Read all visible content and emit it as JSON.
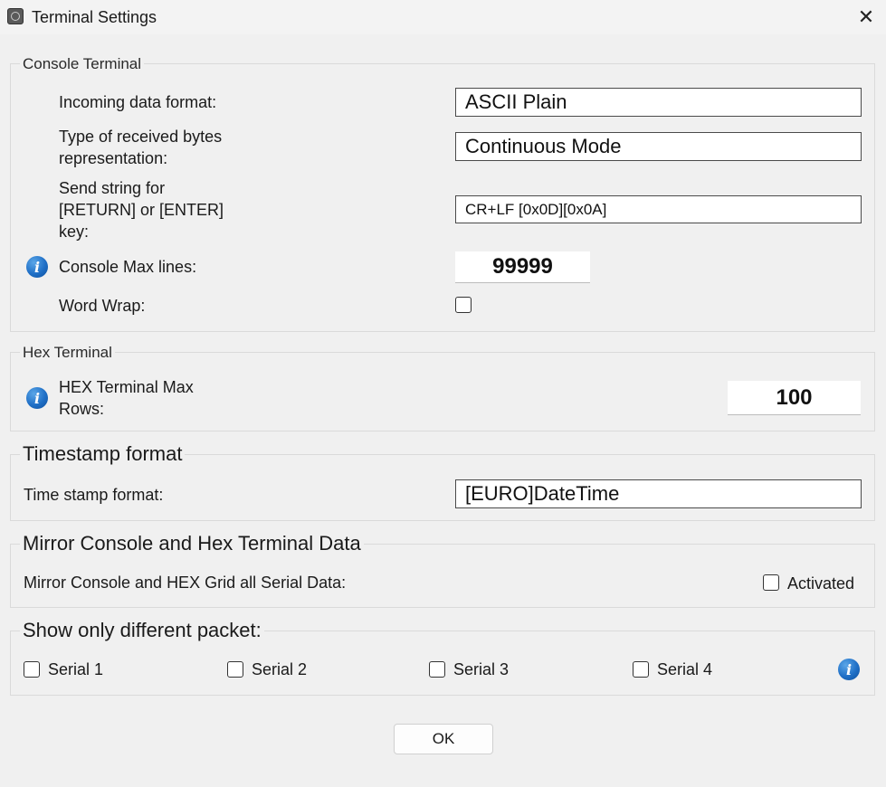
{
  "window": {
    "title": "Terminal Settings",
    "close_glyph": "✕",
    "app_icon": "terminal-app-icon"
  },
  "console_terminal": {
    "legend": "Console Terminal",
    "incoming_label": "Incoming data format:",
    "incoming_value": "ASCII Plain",
    "received_label_line1": "Type of received bytes",
    "received_label_line2": "representation:",
    "received_value": "Continuous Mode",
    "send_label_line1": "Send string for",
    "send_label_line2": "[RETURN] or [ENTER]",
    "send_label_line3": "key:",
    "send_value": "CR+LF [0x0D][0x0A]",
    "max_lines_label": "Console Max lines:",
    "max_lines_value": "99999",
    "word_wrap_label": "Word Wrap:",
    "word_wrap_checked": false
  },
  "hex_terminal": {
    "legend": "Hex Terminal",
    "max_rows_label_line1": "HEX Terminal Max",
    "max_rows_label_line2": "Rows:",
    "max_rows_value": "100"
  },
  "timestamp": {
    "legend": "Timestamp format",
    "label": "Time stamp format:",
    "value": "[EURO]DateTime"
  },
  "mirror": {
    "legend": "Mirror Console and Hex Terminal Data",
    "label": "Mirror Console and HEX Grid all Serial Data:",
    "checkbox_label": "Activated",
    "checked": false
  },
  "different_packet": {
    "legend": "Show only different packet:",
    "serials": [
      {
        "label": "Serial 1",
        "checked": false
      },
      {
        "label": "Serial 2",
        "checked": false
      },
      {
        "label": "Serial 3",
        "checked": false
      },
      {
        "label": "Serial 4",
        "checked": false
      }
    ]
  },
  "info_glyph": "i",
  "colors": {
    "info_blue": "#1f6fc6",
    "background": "#f0f0f0"
  },
  "ok_button": "OK"
}
